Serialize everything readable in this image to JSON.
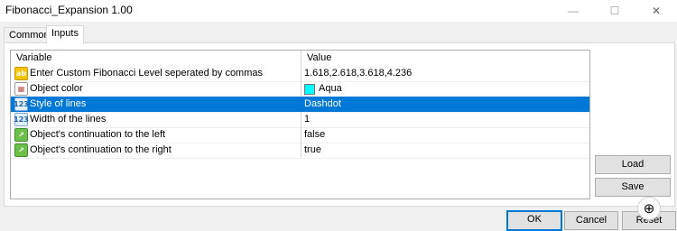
{
  "window": {
    "title": "Fibonacci_Expansion 1.00",
    "minimize_glyph": "—",
    "maximize_glyph": "☐",
    "close_glyph": "✕"
  },
  "tabs": [
    {
      "label": "Common",
      "active": false
    },
    {
      "label": "Inputs",
      "active": true
    }
  ],
  "table": {
    "columns": [
      "Variable",
      "Value"
    ],
    "rows": [
      {
        "icon": "ab-text-icon",
        "icon_glyph": "ab",
        "variable": "Enter Custom Fibonacci Level seperated by commas",
        "value": "1.618,2.618,3.618,4.236"
      },
      {
        "icon": "color-icon",
        "icon_glyph": "▦",
        "variable": "Object color",
        "value": "Aqua",
        "swatch": "#00ffff"
      },
      {
        "icon": "number-icon",
        "icon_glyph": "123",
        "variable": "Style of lines",
        "value": "Dashdot",
        "selected": true
      },
      {
        "icon": "number-icon",
        "icon_glyph": "123",
        "variable": "Width of the lines",
        "value": "1"
      },
      {
        "icon": "bool-icon",
        "icon_glyph": "↗",
        "variable": "Object's continuation to the left",
        "value": "false"
      },
      {
        "icon": "bool-icon",
        "icon_glyph": "↗",
        "variable": "Object's continuation to the right",
        "value": "true"
      }
    ]
  },
  "buttons": {
    "load": "Load",
    "save": "Save",
    "ok": "OK",
    "cancel": "Cancel",
    "reset": "Reset"
  },
  "colors": {
    "selection": "#0078d7",
    "accent": "#0078d7"
  }
}
